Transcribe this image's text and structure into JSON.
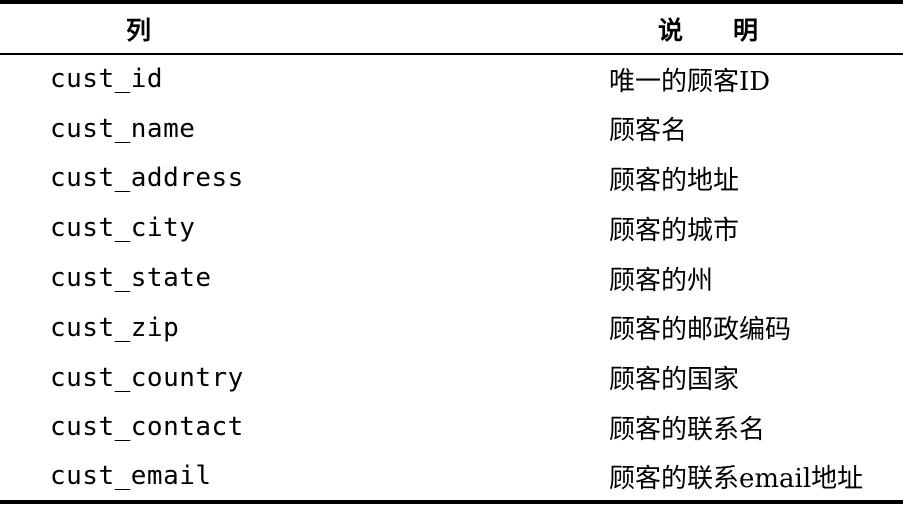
{
  "header": {
    "column": "列",
    "description": "说　　明"
  },
  "rows": [
    {
      "name": "cust_id",
      "desc": "唯一的顾客ID"
    },
    {
      "name": "cust_name",
      "desc": "顾客名"
    },
    {
      "name": "cust_address",
      "desc": "顾客的地址"
    },
    {
      "name": "cust_city",
      "desc": "顾客的城市"
    },
    {
      "name": "cust_state",
      "desc": "顾客的州"
    },
    {
      "name": "cust_zip",
      "desc": "顾客的邮政编码"
    },
    {
      "name": "cust_country",
      "desc": "顾客的国家"
    },
    {
      "name": "cust_contact",
      "desc": "顾客的联系名"
    },
    {
      "name": "cust_email",
      "desc": "顾客的联系email地址"
    }
  ]
}
